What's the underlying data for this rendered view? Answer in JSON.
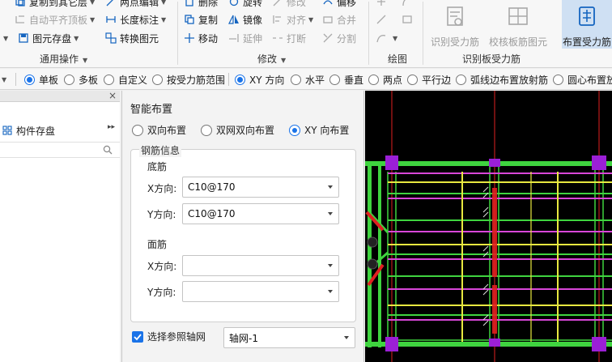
{
  "ribbon": {
    "common_ops": {
      "copy_to_floor": "复制到其它层",
      "auto_flat_slab": "自动平齐顶板",
      "component_save": "图元存盘",
      "twopoint_edit": "两点编辑",
      "length_mark": "长度标注",
      "convert_component": "转换图元",
      "group_label": "通用操作"
    },
    "modify": {
      "delete": "删除",
      "rotate": "旋转",
      "modify2": "修改",
      "offset": "偏移",
      "copy": "复制",
      "mirror": "镜像",
      "align": "对齐",
      "merge": "合并",
      "move": "移动",
      "extend": "延伸",
      "break": "打断",
      "split": "分割",
      "group_label": "修改"
    },
    "draw": {
      "group_label": "绘图"
    },
    "recognize": {
      "identify_rebar": "识别受力筋",
      "check_rebar": "校核板筋图元",
      "layout_rebar": "布置受力筋",
      "group_label": "识别板受力筋"
    }
  },
  "optbar": {
    "items": [
      "单板",
      "多板",
      "自定义",
      "按受力筋范围",
      "XY 方向",
      "水平",
      "垂直",
      "两点",
      "平行边",
      "弧线边布置放射筋",
      "圆心布置放"
    ]
  },
  "left_panel": {
    "close_glyph": "×",
    "tab": "构件存盘",
    "expand_glyph": "▸▸"
  },
  "dialog": {
    "title": "智能布置",
    "modes": [
      "双向布置",
      "双网双向布置",
      "XY 向布置"
    ],
    "selected_mode": "XY 向布置",
    "rebar_info": "钢筋信息",
    "bottom": "底筋",
    "top": "面筋",
    "x_dir": "X方向:",
    "y_dir": "Y方向:",
    "bottom_x": "C10@170",
    "bottom_y": "C10@170",
    "top_x": "",
    "top_y": "",
    "ref_grid_label": "选择参照轴网",
    "ref_grid_checked": true,
    "ref_grid_value": "轴网-1"
  },
  "colors": {
    "accent": "#1a73e8",
    "canvas_bg": "#000000",
    "beam_green": "#3fd43f",
    "rebar_yellow": "#e8e840",
    "rebar_magenta": "#d846d8",
    "axis_red": "#e02020",
    "column_purple": "#9b1fd6"
  }
}
